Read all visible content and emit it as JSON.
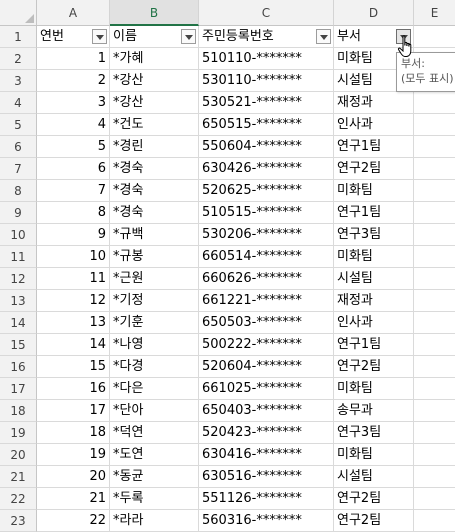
{
  "columns": [
    "A",
    "B",
    "C",
    "D",
    "E"
  ],
  "header_row": {
    "row_num": "1",
    "a": "연번",
    "b": "이름",
    "c": "주민등록번호",
    "d": "부서"
  },
  "rows": [
    {
      "n": "2",
      "a": "1",
      "b": "*가혜",
      "c": "510110-*******",
      "d": "미화팀"
    },
    {
      "n": "3",
      "a": "2",
      "b": "*강산",
      "c": "530110-*******",
      "d": "시설팀"
    },
    {
      "n": "4",
      "a": "3",
      "b": "*강산",
      "c": "530521-*******",
      "d": "재정과"
    },
    {
      "n": "5",
      "a": "4",
      "b": "*건도",
      "c": "650515-*******",
      "d": "인사과"
    },
    {
      "n": "6",
      "a": "5",
      "b": "*경린",
      "c": "550604-*******",
      "d": "연구1팀"
    },
    {
      "n": "7",
      "a": "6",
      "b": "*경숙",
      "c": "630426-*******",
      "d": "연구2팀"
    },
    {
      "n": "8",
      "a": "7",
      "b": "*경숙",
      "c": "520625-*******",
      "d": "미화팀"
    },
    {
      "n": "9",
      "a": "8",
      "b": "*경숙",
      "c": "510515-*******",
      "d": "연구1팀"
    },
    {
      "n": "10",
      "a": "9",
      "b": "*규백",
      "c": "530206-*******",
      "d": "연구3팀"
    },
    {
      "n": "11",
      "a": "10",
      "b": "*규봉",
      "c": "660514-*******",
      "d": "미화팀"
    },
    {
      "n": "12",
      "a": "11",
      "b": "*근원",
      "c": "660626-*******",
      "d": "시설팀"
    },
    {
      "n": "13",
      "a": "12",
      "b": "*기정",
      "c": "661221-*******",
      "d": "재정과"
    },
    {
      "n": "14",
      "a": "13",
      "b": "*기훈",
      "c": "650503-*******",
      "d": "인사과"
    },
    {
      "n": "15",
      "a": "14",
      "b": "*나영",
      "c": "500222-*******",
      "d": "연구1팀"
    },
    {
      "n": "16",
      "a": "15",
      "b": "*다경",
      "c": "520604-*******",
      "d": "연구2팀"
    },
    {
      "n": "17",
      "a": "16",
      "b": "*다은",
      "c": "661025-*******",
      "d": "미화팀"
    },
    {
      "n": "18",
      "a": "17",
      "b": "*단아",
      "c": "650403-*******",
      "d": "송무과"
    },
    {
      "n": "19",
      "a": "18",
      "b": "*덕연",
      "c": "520423-*******",
      "d": "연구3팀"
    },
    {
      "n": "20",
      "a": "19",
      "b": "*도연",
      "c": "630416-*******",
      "d": "미화팀"
    },
    {
      "n": "21",
      "a": "20",
      "b": "*동균",
      "c": "630516-*******",
      "d": "시설팀"
    },
    {
      "n": "22",
      "a": "21",
      "b": "*두록",
      "c": "551126-*******",
      "d": "연구2팀"
    },
    {
      "n": "23",
      "a": "22",
      "b": "*라라",
      "c": "560316-*******",
      "d": "연구2팀"
    }
  ],
  "tooltip": {
    "line1": "부서:",
    "line2": "(모두 표시)"
  },
  "icons": {
    "filter": "filter-dropdown-icon",
    "cursor": "hand-pointer-icon"
  },
  "colors": {
    "selected_accent": "#217346",
    "header_bg": "#f2f2f2",
    "grid_line": "#dadada"
  }
}
